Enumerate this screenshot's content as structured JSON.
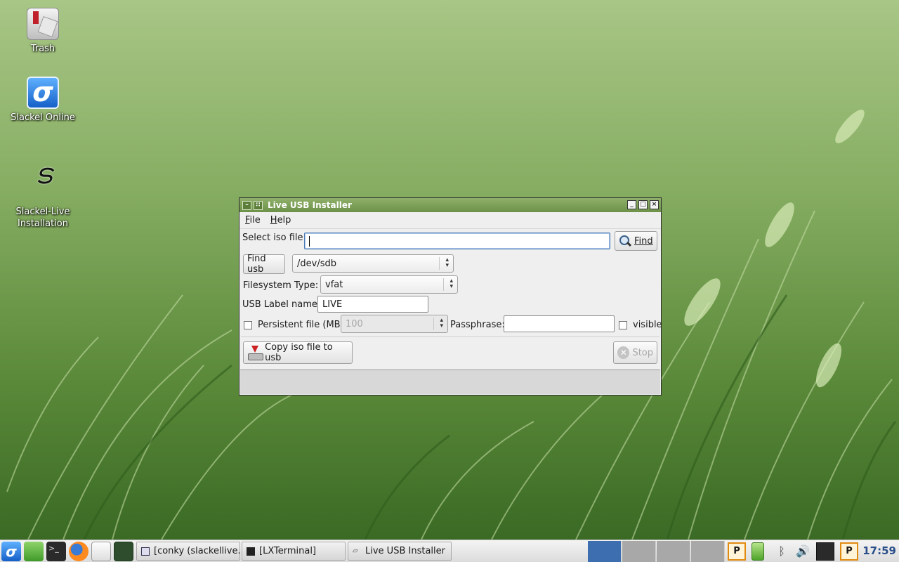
{
  "desktop": {
    "icons": [
      {
        "label": "Trash",
        "icon": "trash-icon"
      },
      {
        "label": "Slackel Online",
        "icon": "slackel-online-icon"
      },
      {
        "label": "Slackel-Live\nInstallation",
        "icon": "slackel-live-icon"
      }
    ]
  },
  "window": {
    "title": "Live USB Installer",
    "menu": {
      "file": "File",
      "help": "Help"
    },
    "iso": {
      "label": "Select iso file:",
      "value": "",
      "find_button": "Find"
    },
    "usb": {
      "find_button": "Find usb",
      "device": "/dev/sdb"
    },
    "filesystem": {
      "label": "Filesystem Type:",
      "value": "vfat"
    },
    "usb_label": {
      "label": "USB Label name:",
      "value": "LIVE"
    },
    "persistent": {
      "label": "Persistent file (MB):",
      "checked": false,
      "value": "100",
      "passphrase_label": "Passphrase:",
      "passphrase_value": "",
      "visible_label": "visible",
      "visible_checked": false
    },
    "copy_button": "Copy iso file to usb",
    "stop_button": "Stop"
  },
  "taskbar": {
    "tasks": [
      {
        "label": "[conky (slackellive..."
      },
      {
        "label": "[LXTerminal]"
      },
      {
        "label": "Live USB Installer"
      }
    ],
    "clock": "17:59"
  },
  "colors": {
    "titlebar": "#7fa25a",
    "accent": "#4a7ab5",
    "clock": "#2a4f8a"
  }
}
